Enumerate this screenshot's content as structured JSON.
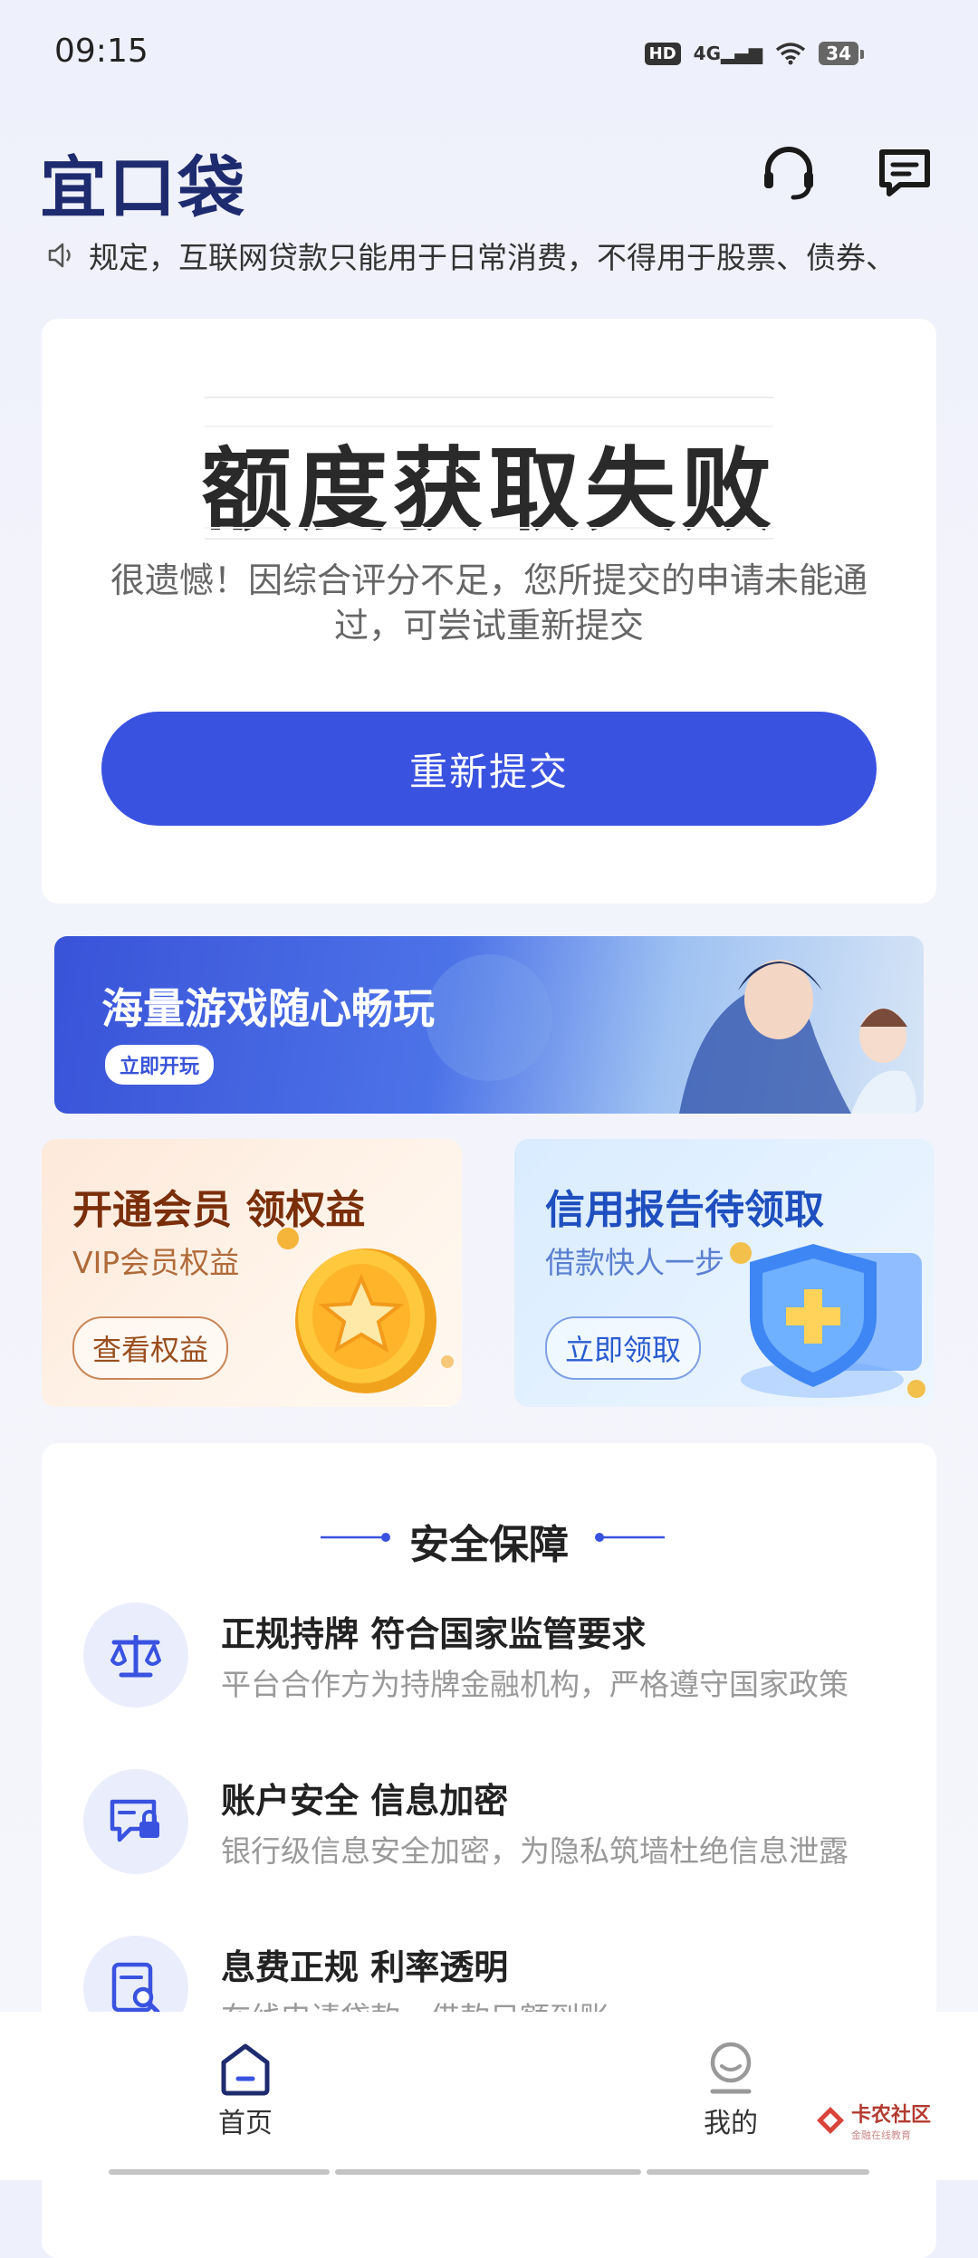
{
  "status_bar": {
    "time": "09:15",
    "hd": "HD",
    "network": "4G",
    "battery": "34"
  },
  "header": {
    "logo": "宜口袋"
  },
  "notice": {
    "text": "规定，互联网贷款只能用于日常消费，不得用于股票、债券、"
  },
  "result": {
    "title": "额度获取失败",
    "description": "很遗憾！因综合评分不足，您所提交的申请未能通过，可尝试重新提交",
    "button": "重新提交"
  },
  "game_banner": {
    "title": "海量游戏随心畅玩",
    "button": "立即开玩"
  },
  "promos": [
    {
      "title": "开通会员 领权益",
      "subtitle": "VIP会员权益",
      "button": "查看权益"
    },
    {
      "title": "信用报告待领取",
      "subtitle": "借款快人一步",
      "button": "立即领取"
    }
  ],
  "security": {
    "title": "安全保障",
    "items": [
      {
        "title": "正规持牌 符合国家监管要求",
        "subtitle": "平台合作方为持牌金融机构，严格遵守国家政策"
      },
      {
        "title": "账户安全 信息加密",
        "subtitle": "银行级信息安全加密，为隐私筑墙杜绝信息泄露"
      },
      {
        "title": "息费正规  利率透明",
        "subtitle": "在线申请贷款，借款只额到账"
      }
    ]
  },
  "bottom_nav": {
    "home": "首页",
    "mine": "我的"
  },
  "watermark": {
    "text": "卡农社区",
    "sub": "金融在线教育"
  },
  "colors": {
    "primary": "#3a52e0",
    "vip": "#8a3a10",
    "credit": "#2a5bd0"
  }
}
